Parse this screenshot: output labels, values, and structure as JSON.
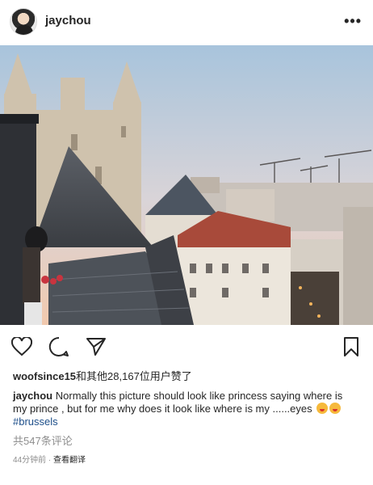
{
  "header": {
    "username": "jaychou",
    "avatar_icon": "profile-avatar",
    "more_icon": "more-horizontal-icon",
    "more_label": "•••"
  },
  "photo": {
    "description_icon": "photo-of-city-rooftops"
  },
  "actions": {
    "like_icon": "heart-icon",
    "comment_icon": "comment-bubble-icon",
    "share_icon": "paper-plane-icon",
    "save_icon": "bookmark-icon"
  },
  "likes": {
    "first_user": "woofsince15",
    "text": "和其他28,167位用户赞了"
  },
  "caption": {
    "username": "jaychou",
    "line1": "Normally this picture should look like princess saying where is my prince , but for me why does it look like where is my ......eyes",
    "emoji_1": "squinting-face-with-tongue",
    "emoji_2": "squinting-face-with-tongue",
    "hashtag": "#brussels"
  },
  "comments": {
    "text": "共547条评论"
  },
  "meta": {
    "time": "44分钟前",
    "separator": " · ",
    "translate": "查看翻译"
  },
  "colors": {
    "text": "#262626",
    "muted": "#8e8e8e",
    "hashtag": "#1e4f8a"
  }
}
